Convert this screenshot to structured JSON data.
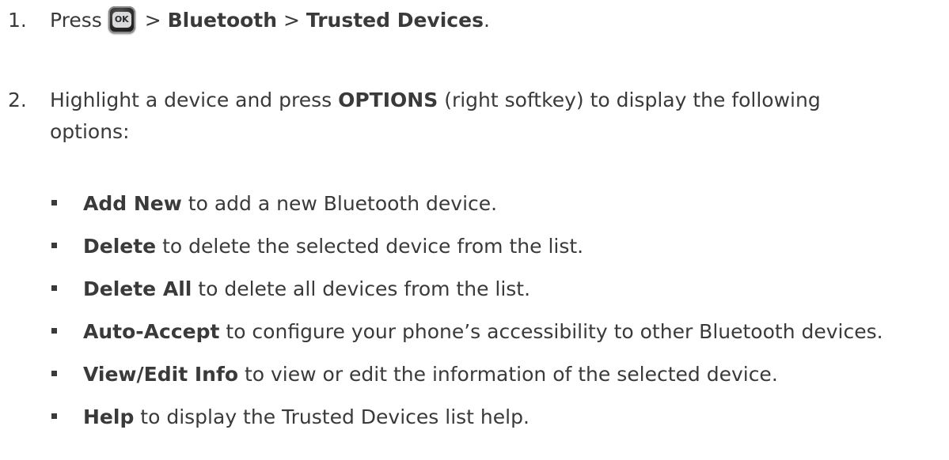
{
  "steps": [
    {
      "number": "1.",
      "prefix": "Press",
      "ok_key_label": "OK",
      "sep1": ">",
      "item1": "Bluetooth",
      "sep2": ">",
      "item2": "Trusted Devices",
      "suffix": "."
    },
    {
      "number": "2.",
      "text_a": "Highlight a device and press",
      "bold": "OPTIONS",
      "text_b": "(right softkey) to display the following",
      "text_c": "options:"
    }
  ],
  "options": [
    {
      "bold": "Add New",
      "text": "to add a new Bluetooth device."
    },
    {
      "bold": "Delete",
      "text": "to delete the selected device from the list."
    },
    {
      "bold": "Delete All",
      "text": "to delete all devices from the list."
    },
    {
      "bold": "Auto-Accept",
      "text": "to configure your phone’s accessibility to other Bluetooth devices."
    },
    {
      "bold": "View/Edit Info",
      "text": "to view or edit the information of the selected device."
    },
    {
      "bold": "Help",
      "text": "to display the Trusted Devices list help."
    }
  ],
  "icons": {
    "ok_key": "ok-key-icon",
    "bullet": "square-bullet-icon"
  }
}
